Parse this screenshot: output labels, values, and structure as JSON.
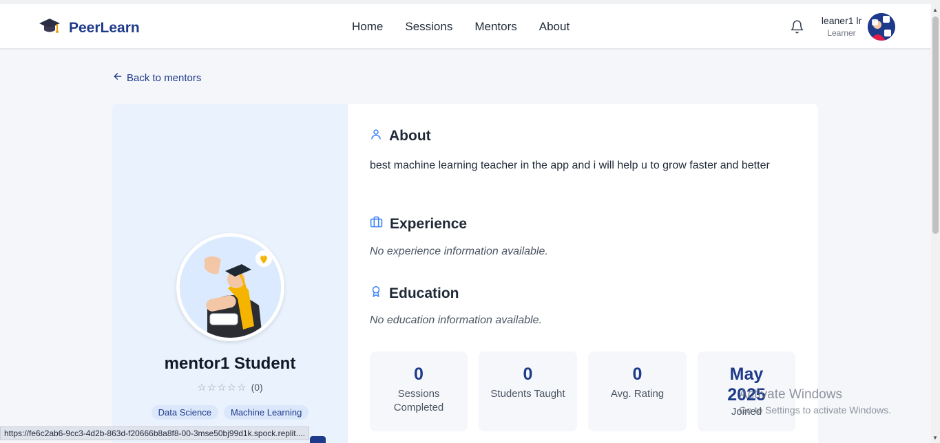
{
  "brand": {
    "name": "PeerLearn",
    "icon": "graduation-cap-icon"
  },
  "nav": {
    "items": [
      "Home",
      "Sessions",
      "Mentors",
      "About"
    ]
  },
  "user": {
    "name": "leaner1 lr",
    "role": "Learner"
  },
  "back_link": "Back to mentors",
  "mentor": {
    "name": "mentor1 Student",
    "rating_count": "(0)",
    "rating": 0,
    "tags": [
      "Data Science",
      "Machine Learning"
    ]
  },
  "sections": {
    "about": {
      "title": "About",
      "text": "best machine learning teacher in the app and i will help u to grow faster and better"
    },
    "experience": {
      "title": "Experience",
      "text": "No experience information available."
    },
    "education": {
      "title": "Education",
      "text": "No education information available."
    }
  },
  "stats": [
    {
      "value": "0",
      "label": "Sessions Completed"
    },
    {
      "value": "0",
      "label": "Students Taught"
    },
    {
      "value": "0",
      "label": "Avg. Rating"
    },
    {
      "value": "May 2025",
      "label": "Joined"
    }
  ],
  "status_url": "https://fe6c2ab6-9cc3-4d2b-863d-f20666b8a8f8-00-3mse50bj99d1k.spock.replit....",
  "watermark": {
    "title": "Activate Windows",
    "subtitle": "Go to Settings to activate Windows."
  },
  "colors": {
    "primary": "#1e3a8a",
    "accent_icon": "#3b82f6",
    "left_panel": "#eaf2fd"
  }
}
